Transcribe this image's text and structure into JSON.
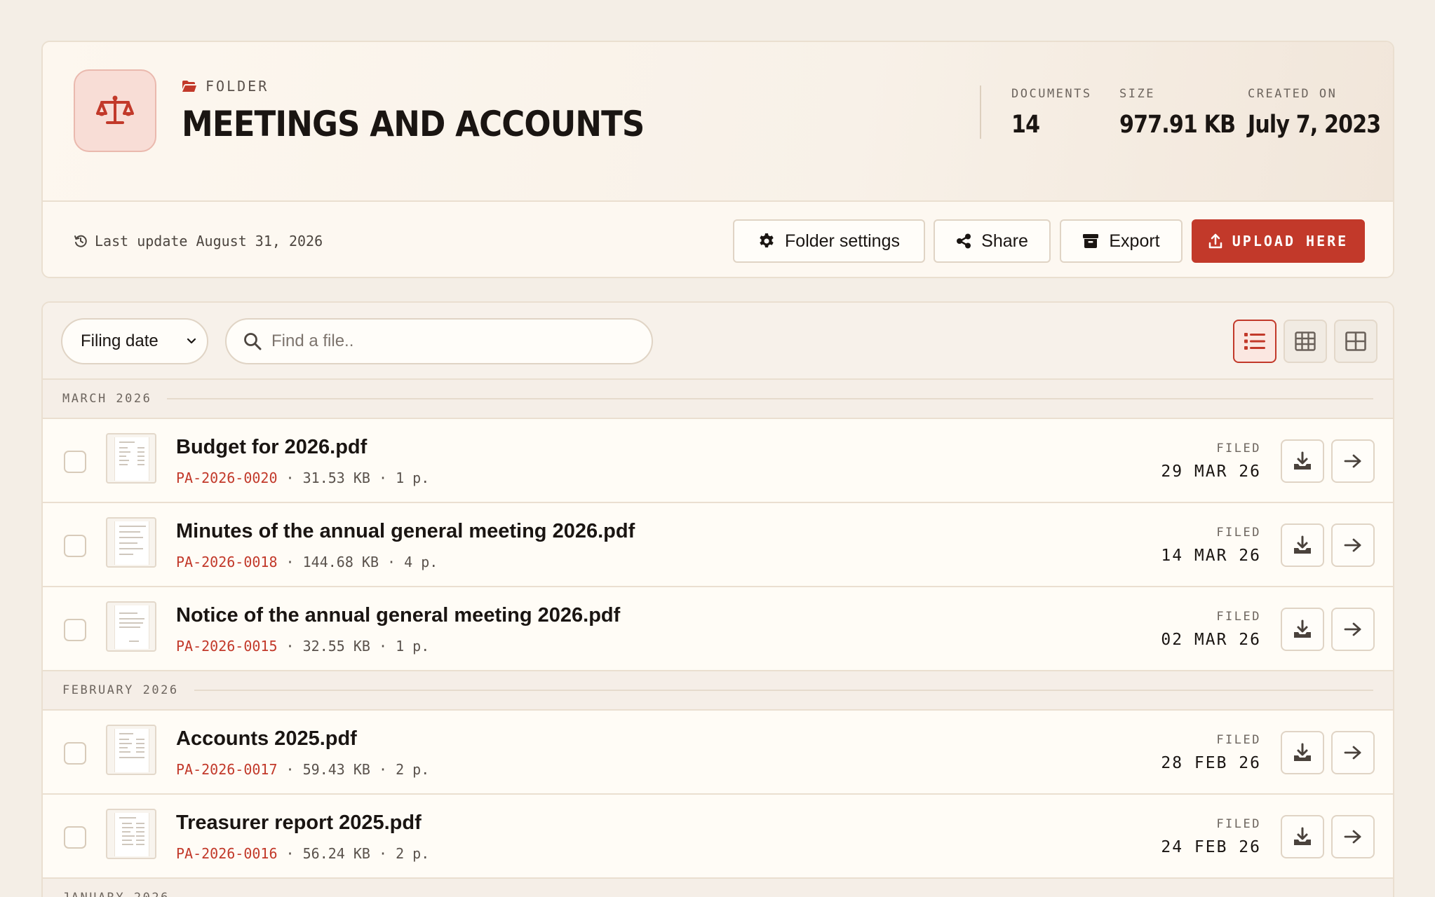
{
  "folder": {
    "kicker": "FOLDER",
    "title": "MEETINGS AND ACCOUNTS",
    "emblem_icon": "scales-icon",
    "accent_color": "#c2392a"
  },
  "stats": [
    {
      "label": "DOCUMENTS",
      "value": "14"
    },
    {
      "label": "SIZE",
      "value": "977.91 KB"
    },
    {
      "label": "CREATED ON",
      "value": "July 7, 2023"
    }
  ],
  "last_update": "Last update August 31, 2026",
  "actions": {
    "folder_settings": "Folder settings",
    "share": "Share",
    "export": "Export",
    "upload": "UPLOAD HERE"
  },
  "toolbar": {
    "sort_selected": "Filing date",
    "search_placeholder": "Find a file.."
  },
  "groups": [
    {
      "label": "MARCH 2026",
      "files": [
        {
          "name": "Budget for 2026.pdf",
          "ref": "PA-2026-0020",
          "size": "31.53 KB",
          "pages": "1 p.",
          "filed_label": "FILED",
          "filed_date": "29 MAR 26"
        },
        {
          "name": "Minutes of the annual general meeting 2026.pdf",
          "ref": "PA-2026-0018",
          "size": "144.68 KB",
          "pages": "4 p.",
          "filed_label": "FILED",
          "filed_date": "14 MAR 26"
        },
        {
          "name": "Notice of the annual general meeting 2026.pdf",
          "ref": "PA-2026-0015",
          "size": "32.55 KB",
          "pages": "1 p.",
          "filed_label": "FILED",
          "filed_date": "02 MAR 26"
        }
      ]
    },
    {
      "label": "FEBRUARY 2026",
      "files": [
        {
          "name": "Accounts 2025.pdf",
          "ref": "PA-2026-0017",
          "size": "59.43 KB",
          "pages": "2 p.",
          "filed_label": "FILED",
          "filed_date": "28 FEB 26"
        },
        {
          "name": "Treasurer report 2025.pdf",
          "ref": "PA-2026-0016",
          "size": "56.24 KB",
          "pages": "2 p.",
          "filed_label": "FILED",
          "filed_date": "24 FEB 26"
        }
      ]
    },
    {
      "label": "JANUARY 2026",
      "files": []
    }
  ]
}
